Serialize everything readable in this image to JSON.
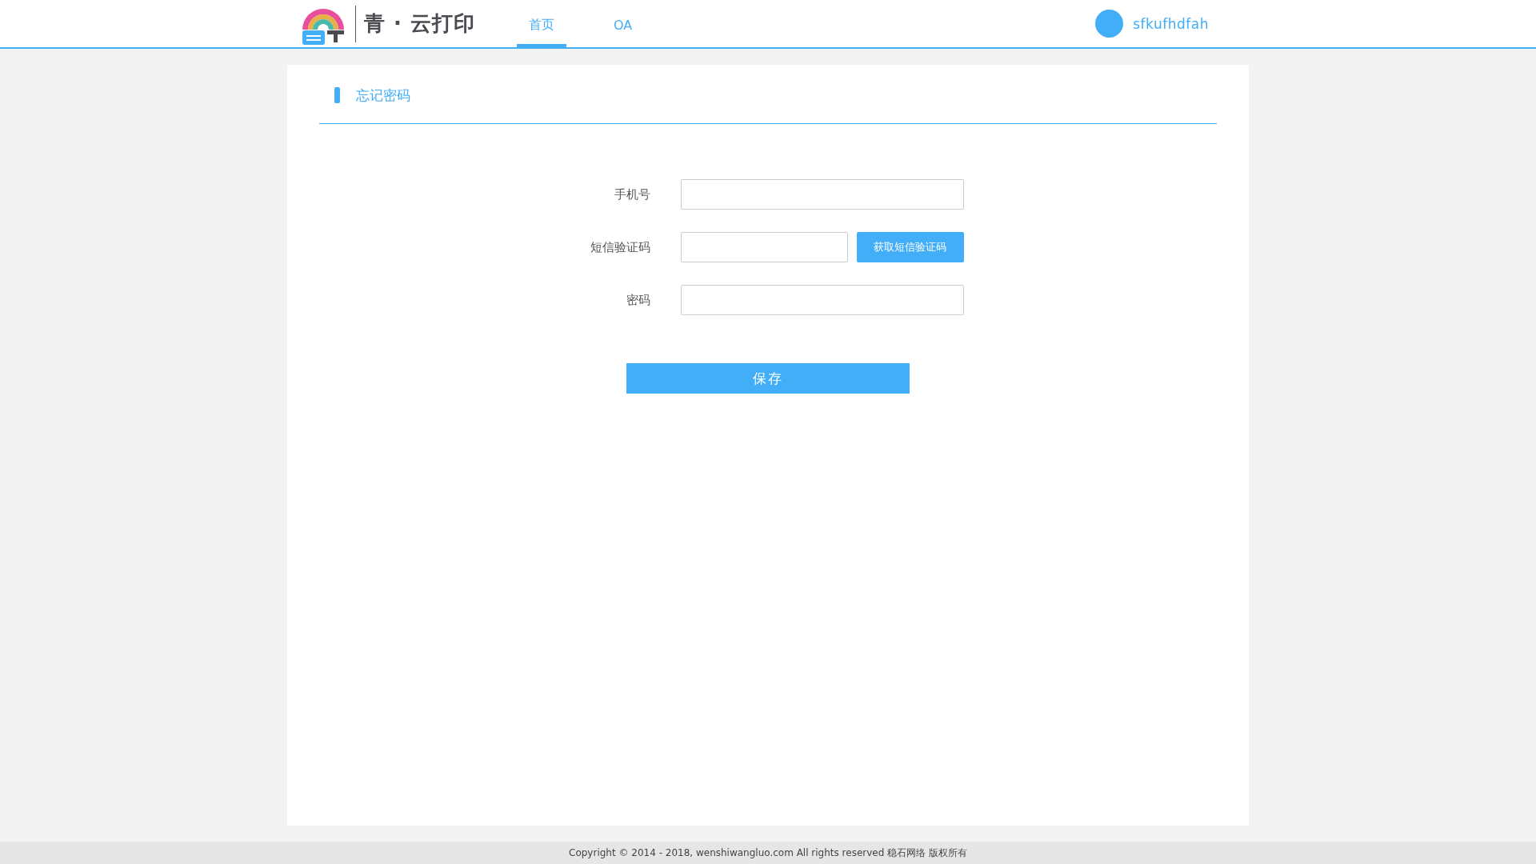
{
  "header": {
    "brand": "青 · 云打印",
    "nav": [
      {
        "label": "首页",
        "selected": true
      },
      {
        "label": "OA",
        "selected": false
      }
    ],
    "user": {
      "name": "sfkufhdfah"
    }
  },
  "panel": {
    "title": "忘记密码"
  },
  "form": {
    "fields": [
      {
        "label": "手机号",
        "kind": "text"
      },
      {
        "label": "短信验证码",
        "kind": "code",
        "button": "获取短信验证码"
      },
      {
        "label": "密码",
        "kind": "password"
      }
    ],
    "submit": "保存"
  },
  "footer": {
    "text": "Copyright © 2014 - 2018, wenshiwangluo.com All rights reserved 稳石网络 版权所有"
  }
}
